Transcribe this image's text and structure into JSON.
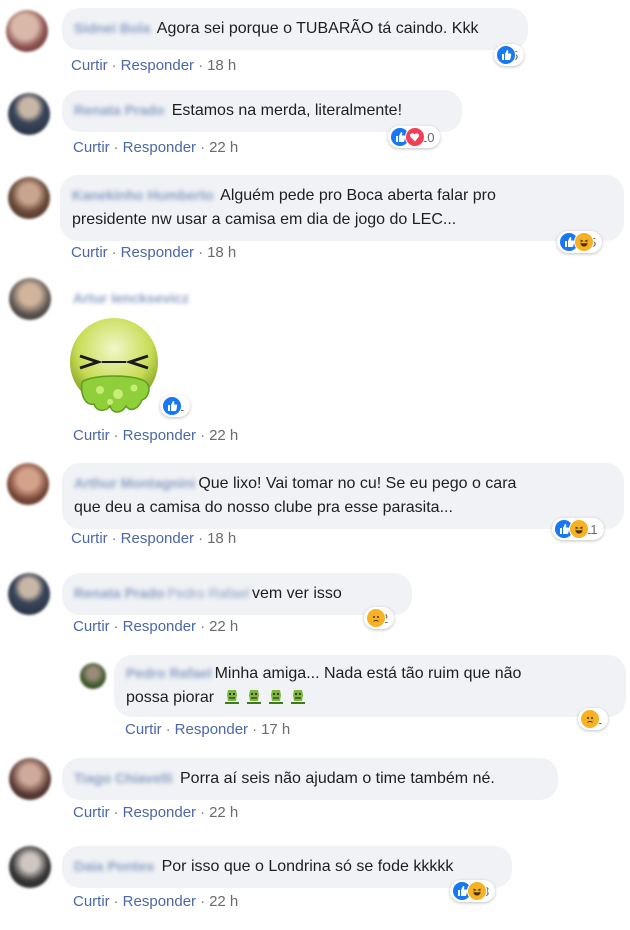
{
  "actions": {
    "like": "Curtir",
    "reply": "Responder",
    "sep": "·"
  },
  "comments": [
    {
      "author": "Sidnei Bola",
      "lines": [
        "Agora sei porque o TUBARÃO tá caindo. Kkk"
      ],
      "time": "18 h",
      "reactions": [
        "like"
      ],
      "count": "5"
    },
    {
      "author": "Renata Prado",
      "lines": [
        "Estamos na merda, literalmente!"
      ],
      "time": "22 h",
      "reactions": [
        "like",
        "love"
      ],
      "count": "10"
    },
    {
      "author": "Kanekinho Humberto",
      "lines": [
        "Alguém pede pro Boca aberta falar pro",
        "presidente nw usar a camisa em dia de jogo do LEC..."
      ],
      "time": "18 h",
      "reactions": [
        "like",
        "haha"
      ],
      "count": "5"
    },
    {
      "author": "Artur Iencksevicz",
      "sticker": "vomiting-sticker",
      "time": "22 h",
      "reactions": [
        "like"
      ],
      "count": "1"
    },
    {
      "author": "Arthur Montagnini",
      "lines": [
        "Que lixo! Vai tomar no cu! Se eu pego o cara",
        "que deu a camisa do nosso clube pra esse parasita..."
      ],
      "time": "18 h",
      "reactions": [
        "like",
        "haha"
      ],
      "count": "11"
    },
    {
      "author": "Renata Prado",
      "tag": "Pedro Rafael",
      "lines": [
        "vem ver isso"
      ],
      "time": "22 h",
      "reactions": [
        "sad"
      ],
      "count": "2"
    },
    {
      "author": "Pedro Rafael",
      "lines": [
        "Minha amiga... Nada está tão ruim que não",
        "possa piorar"
      ],
      "time": "17 h",
      "reactions": [
        "sad"
      ],
      "count": "1",
      "emoji": "nauseated-face-icon"
    },
    {
      "author": "Tiago Chiavelli",
      "lines": [
        "Porra aí seis não ajudam o time também né."
      ],
      "time": "22 h"
    },
    {
      "author": "Daia Pontes",
      "lines": [
        "Por isso que o Londrina só se fode kkkkk"
      ],
      "time": "22 h",
      "reactions": [
        "like",
        "haha"
      ],
      "count": "8"
    }
  ],
  "colors": {
    "bubble": "#f0f2f5",
    "like": "#1877f2",
    "love": "#f33e58",
    "haha": "#f7b125",
    "link": "#4b67a8"
  }
}
